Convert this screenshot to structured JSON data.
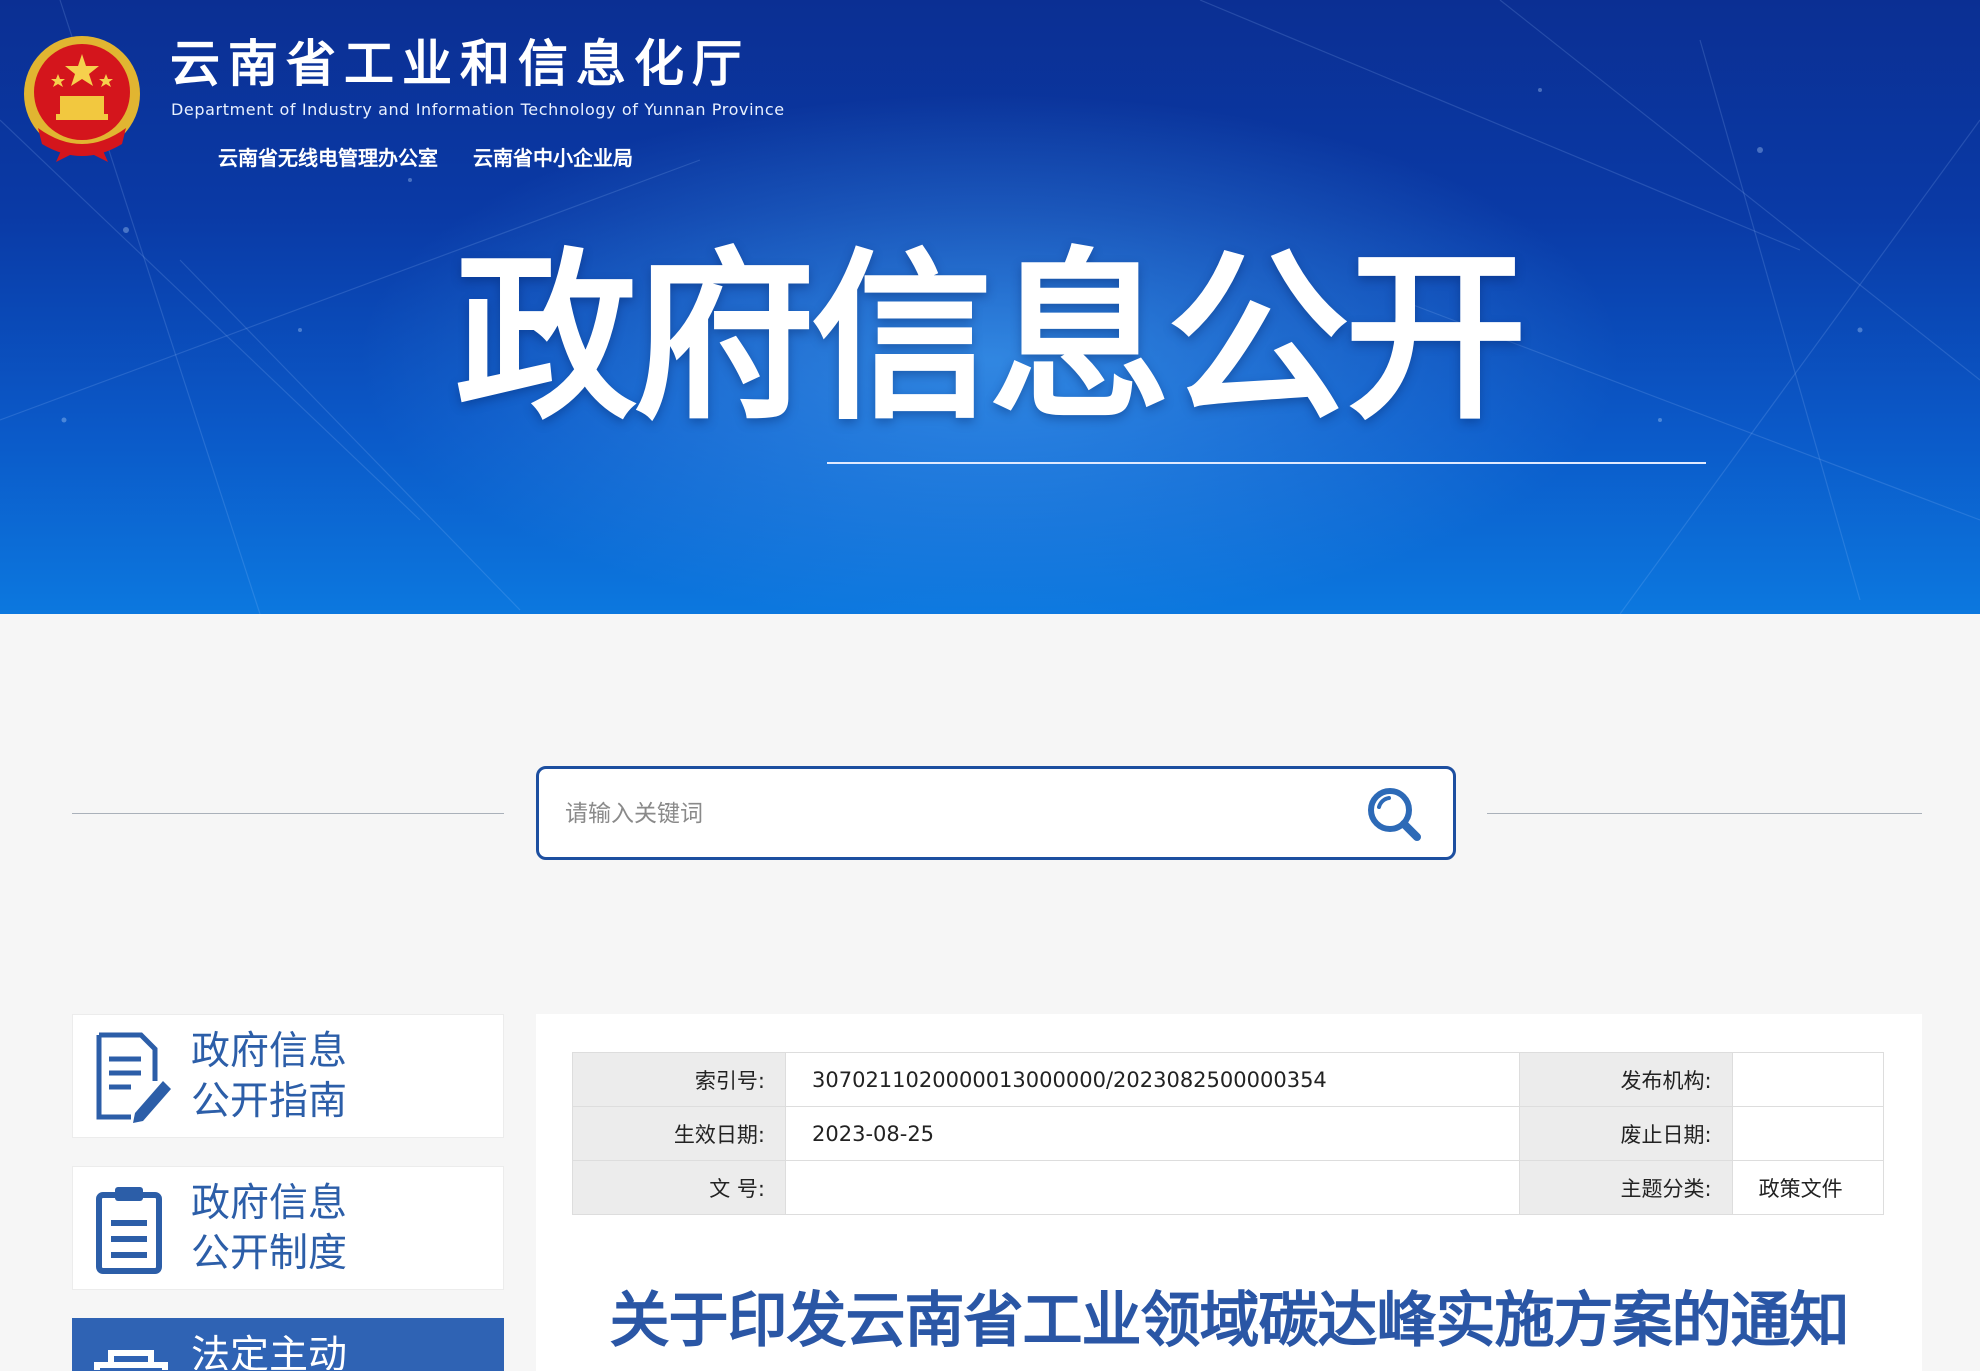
{
  "header": {
    "org_name_cn": "云南省工业和信息化厅",
    "org_name_en": "Department of Industry and Information Technology of Yunnan Province",
    "sub_offices": [
      "云南省无线电管理办公室",
      "云南省中小企业局"
    ],
    "hero_title": "政府信息公开"
  },
  "search": {
    "placeholder": "请输入关键词",
    "value": "",
    "icon": "search-icon"
  },
  "sidebar": {
    "items": [
      {
        "label_line1": "政府信息",
        "label_line2": "公开指南",
        "icon": "document-edit-icon",
        "active": false
      },
      {
        "label_line1": "政府信息",
        "label_line2": "公开制度",
        "icon": "clipboard-list-icon",
        "active": false
      },
      {
        "label_line1": "法定主动",
        "label_line2": "",
        "icon": "folder-icon",
        "active": true
      }
    ]
  },
  "meta": {
    "rows": [
      [
        {
          "key": "索引号:",
          "value": "3070211020000013000000/2023082500000354"
        },
        {
          "key": "发布机构:",
          "value": ""
        }
      ],
      [
        {
          "key": "生效日期:",
          "value": "2023-08-25"
        },
        {
          "key": "废止日期:",
          "value": ""
        }
      ],
      [
        {
          "key": "文 号:",
          "value": ""
        },
        {
          "key": "主题分类:",
          "value": "政策文件"
        }
      ]
    ]
  },
  "document": {
    "title": "关于印发云南省工业领域碳达峰实施方案的通知"
  },
  "colors": {
    "banner_dark": "#0b2f93",
    "banner_light": "#0c78df",
    "accent_blue": "#2c5ea8",
    "active_card": "#2f63b4",
    "search_border": "#1d4fa0",
    "title_blue": "#2a56a5"
  }
}
